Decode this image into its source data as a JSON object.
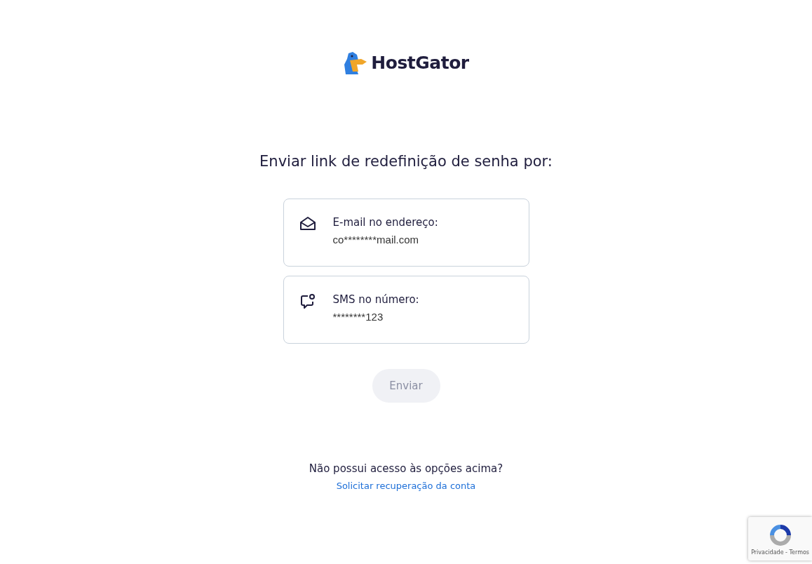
{
  "logo": {
    "text": "HostGator"
  },
  "heading": "Enviar link de redefinição de senha por:",
  "options": [
    {
      "kind": "email",
      "label": "E-mail no endereço:",
      "value": "co********mail.com",
      "selected": false
    },
    {
      "kind": "sms",
      "label": "SMS no número:",
      "value": "********123",
      "selected": false
    }
  ],
  "submit": {
    "label": "Enviar",
    "disabled": true
  },
  "help": {
    "question": "Não possui acesso às opções acima?",
    "link": "Solicitar recuperação da conta"
  },
  "recaptcha": {
    "text": "Privacidade - Termos"
  }
}
